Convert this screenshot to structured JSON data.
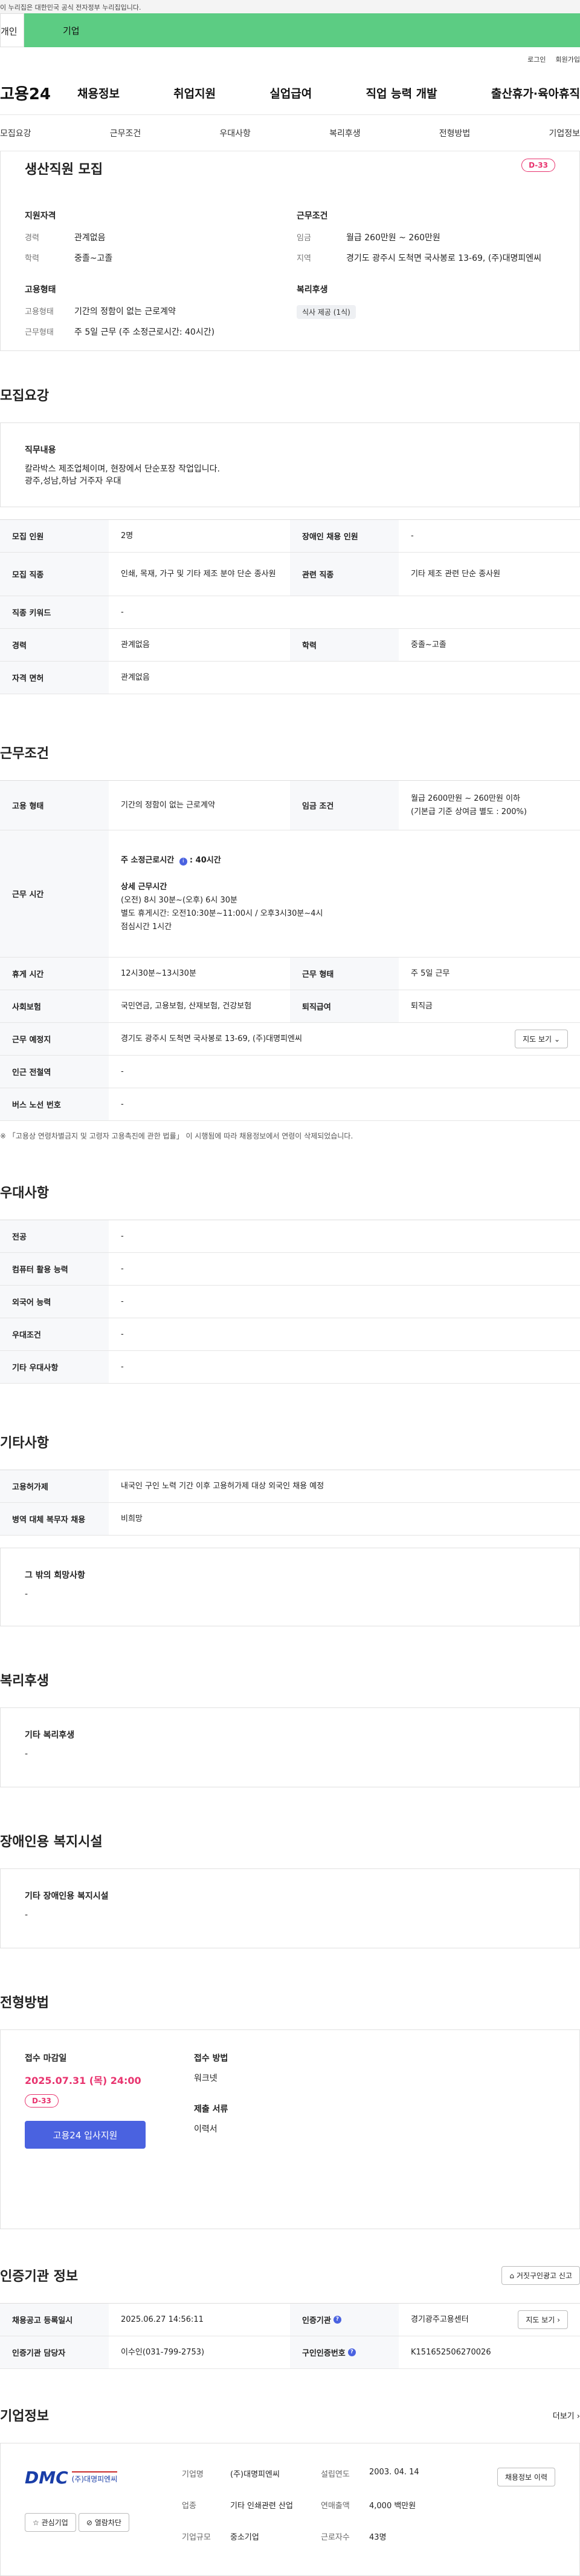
{
  "gov_banner": "이 누리집은 대한민국 공식 전자정부 누리집입니다.",
  "user_tabs": {
    "personal": "개인",
    "company": "기업"
  },
  "util_links": {
    "login": "로그인",
    "signup": "회원가입"
  },
  "logo": "고용24",
  "gnb": [
    "채용정보",
    "취업지원",
    "실업급여",
    "직업 능력 개발",
    "출산휴가·육아휴직"
  ],
  "subnav": [
    "모집요강",
    "근무조건",
    "우대사항",
    "복리후생",
    "전형방법",
    "기업정보"
  ],
  "summary": {
    "title": "생산직원 모집",
    "dday": "D-33",
    "qualification": {
      "heading": "지원자격",
      "career_label": "경력",
      "career": "관계없음",
      "edu_label": "학력",
      "edu": "중졸~고졸"
    },
    "conditions": {
      "heading": "근무조건",
      "wage_label": "임금",
      "wage": "월급 260만원 ~ 260만원",
      "region_label": "지역",
      "region": "경기도 광주시 도척면 국사봉로 13-69, (주)대명피엔씨"
    },
    "employment": {
      "heading": "고용형태",
      "type_label": "고용형태",
      "type": "기간의 정함이 없는 근로계약",
      "worktype_label": "근무형태",
      "worktype": "주 5일 근무 (주 소정근로시간: 40시간)"
    },
    "welfare": {
      "heading": "복리후생",
      "pill": "식사 제공 (1식)"
    }
  },
  "recruit": {
    "title": "모집요강",
    "duty_label": "직무내용",
    "duty_text": "칼라박스 제조업체이며, 현장에서 단순포장 작업입니다.",
    "duty_text2": "광주,성남,하남 거주자 우대",
    "rows": {
      "count_label": "모집 인원",
      "count": "2명",
      "disabled_label": "장애인 채용 인원",
      "disabled": "-",
      "job_label": "모집 직종",
      "job": "인쇄, 목재, 가구 및 기타 제조 분야 단순 종사원",
      "related_label": "관련 직종",
      "related": "기타 제조 관련 단순 종사원",
      "keyword_label": "직종 키워드",
      "keyword": "-",
      "career_label": "경력",
      "career": "관계없음",
      "edu_label": "학력",
      "edu": "중졸~고졸",
      "license_label": "자격 면허",
      "license": "관계없음"
    }
  },
  "work": {
    "title": "근무조건",
    "emp_type_label": "고용 형태",
    "emp_type": "기간의 정함이 없는 근로계약",
    "wage_label": "임금 조건",
    "wage1": "월급 2600만원 ~ 260만원 이하",
    "wage2": "(기본급 기준 상여금 별도 : 200%)",
    "hours_label": "근무 시간",
    "hours_week": "주 소정근로시간 ",
    "hours_week_val": ": 40시간",
    "hours_detail_label": "상세 근무시간",
    "hours_detail1": "(오전) 8시 30분~(오후) 6시 30분",
    "hours_detail2": "별도 휴게시간: 오전10:30분~11:00시  /  오후3시30분~4시",
    "hours_detail3": "점심시간 1시간",
    "break_label": "휴게 시간",
    "break": "12시30분~13시30분",
    "form_label": "근무 형태",
    "form": "주 5일 근무",
    "insurance_label": "사회보험",
    "insurance": "국민연금, 고용보험, 산재보험, 건강보험",
    "severance_label": "퇴직급여",
    "severance": "퇴직금",
    "place_label": "근무 예정지",
    "place": "경기도 광주시 도척면 국사봉로 13-69, (주)대명피엔씨",
    "map_button": "지도 보기",
    "station_label": "인근 전철역",
    "station": "-",
    "bus_label": "버스 노선 번호",
    "bus": "-",
    "notice": "※ 「고용상 연령차별금지 및 고령자 고용촉진에 관한 법률」 이 시행됨에 따라 채용정보에서 연령이 삭제되었습니다."
  },
  "pref": {
    "title": "우대사항",
    "major_label": "전공",
    "major": "-",
    "computer_label": "컴퓨터 활용 능력",
    "computer": "-",
    "lang_label": "외국어 능력",
    "lang": "-",
    "cond_label": "우대조건",
    "cond": "-",
    "etc_label": "기타 우대사항",
    "etc": "-"
  },
  "other": {
    "title": "기타사항",
    "foreign_label": "고용허가제",
    "foreign": "내국인 구인 노력 기간 이후 고용허가제 대상 외국인 채용 예정",
    "military_label": "병역 대체 복무자 채용",
    "military": "비희망",
    "wish_label": "그 밖의 희망사항",
    "wish": "-"
  },
  "welfare": {
    "title": "복리후생",
    "label": "기타 복리후생",
    "value": "-"
  },
  "disabled_facility": {
    "title": "장애인용 복지시설",
    "label": "기타 장애인용 복지시설",
    "value": "-"
  },
  "apply": {
    "title": "전형방법",
    "deadline_label": "접수 마감일",
    "deadline": "2025.07.31 (목) 24:00",
    "dday": "D-33",
    "apply_button": "고용24 입사지원",
    "method_label": "접수 방법",
    "method": "워크넷",
    "docs_label": "제출 서류",
    "docs": "이력서"
  },
  "agency": {
    "title": "인증기관 정보",
    "report_button": "거짓구인광고 신고",
    "reg_date_label": "채용공고 등록일시",
    "reg_date": "2025.06.27 14:56:11",
    "agency_label": "인증기관",
    "agency": "경기광주고용센터",
    "map_button": "지도 보기",
    "manager_label": "인증기관 담당자",
    "manager": "이수인(031-799-2753)",
    "cert_label": "구인인증번호",
    "cert": "K151652506270026"
  },
  "company": {
    "title": "기업정보",
    "more": "더보기",
    "logo_mark": "DMC",
    "logo_text": "(주)대명피엔씨",
    "fav_button": "관심기업",
    "block_button": "열람차단",
    "name_label": "기업명",
    "name": "(주)대명피엔씨",
    "year_label": "설립연도",
    "year": "2003. 04. 14",
    "history_button": "채용정보 이력",
    "biz_label": "업종",
    "biz": "기타 인쇄관련 산업",
    "sales_label": "연매출액",
    "sales": "4,000 백만원",
    "scale_label": "기업규모",
    "scale": "중소기업",
    "staff_label": "근로자수",
    "staff": "43명"
  }
}
